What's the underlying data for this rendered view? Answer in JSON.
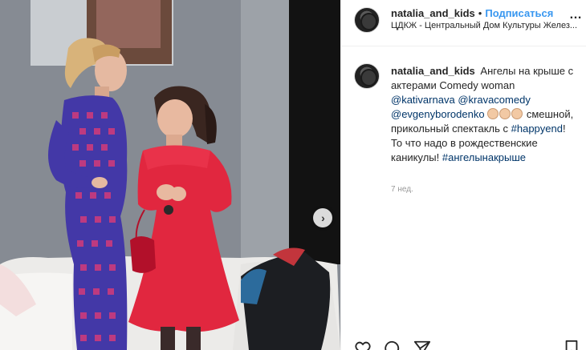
{
  "post": {
    "username": "natalia_and_kids",
    "separator": "•",
    "follow_label": "Подписаться",
    "location": "ЦДКЖ - Центральный Дом Культуры Желез...",
    "more_icon": "…"
  },
  "caption": {
    "username": "natalia_and_kids",
    "text1": "Ангелы на крыше с актерами Comedy woman",
    "mention1": "@kativarnava",
    "mention2": "@kravacomedy",
    "mention3": "@evgenyborodenko",
    "text2": "смешной, прикольный спектакль с",
    "hashtag1": "#happyend",
    "text3": "! То что надо в рождественские каникулы!",
    "hashtag2": "#ангелынакрыше",
    "clap_icon": "clapping-hands-emoji"
  },
  "time_ago": "7 нед.",
  "carousel": {
    "next_label": "›"
  },
  "colors": {
    "link": "#003569",
    "follow": "#3897f0",
    "muted": "#999999",
    "text": "#262626"
  }
}
